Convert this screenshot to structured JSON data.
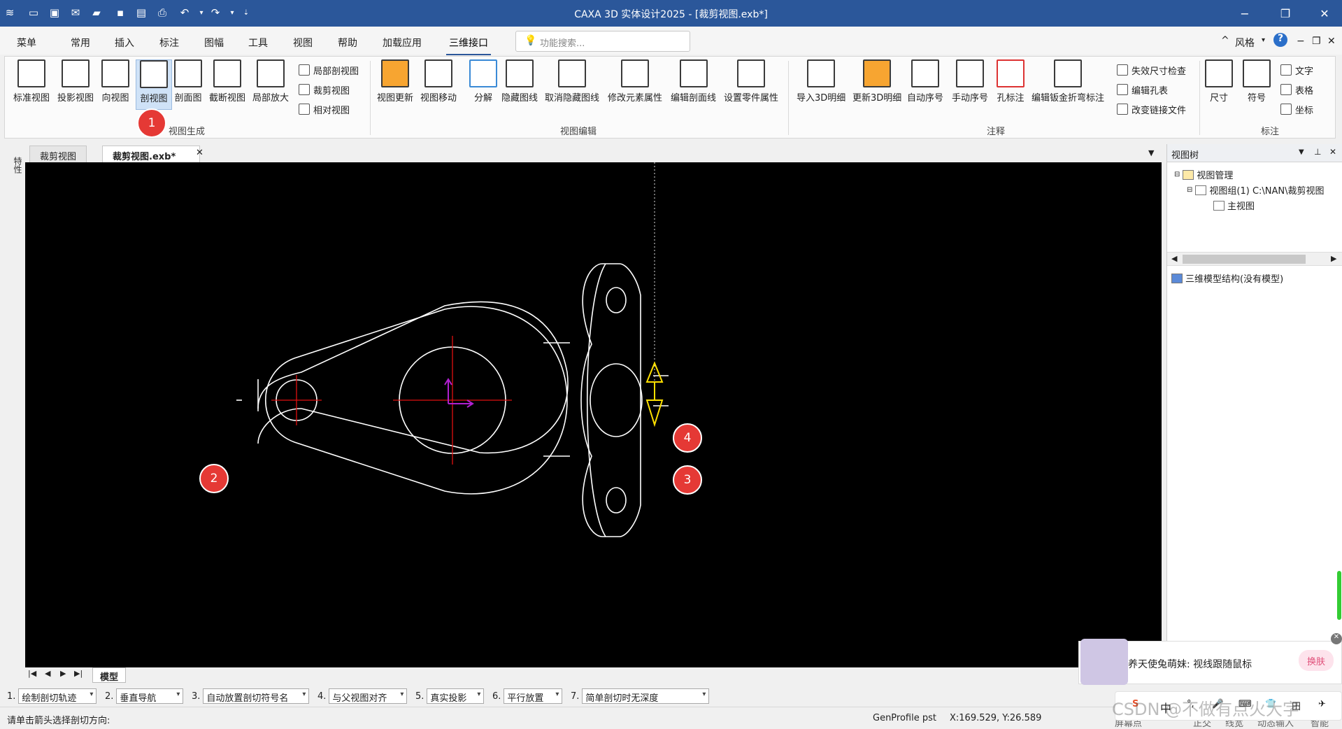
{
  "window": {
    "title": "CAXA 3D 实体设计2025 - [裁剪视图.exb*]",
    "minimize": "−",
    "maximize": "❐",
    "close": "✕"
  },
  "menubar": {
    "items": [
      "菜单",
      "常用",
      "插入",
      "标注",
      "图幅",
      "工具",
      "视图",
      "帮助",
      "加载应用",
      "三维接口"
    ],
    "active": "三维接口",
    "search_placeholder": "功能搜索...",
    "style_label": "风格",
    "help": "?"
  },
  "ribbon": {
    "groups": [
      {
        "name": "视图生成"
      },
      {
        "name": "视图编辑"
      },
      {
        "name": "注释"
      },
      {
        "name": "标注"
      }
    ],
    "view_gen": [
      "标准视图",
      "投影视图",
      "向视图",
      "剖视图",
      "剖面图",
      "截断视图",
      "局部放大"
    ],
    "view_gen_small": [
      "局部剖视图",
      "裁剪视图",
      "相对视图"
    ],
    "view_edit": [
      "视图更新",
      "视图移动",
      "分解",
      "隐藏图线",
      "取消隐藏图线",
      "修改元素属性",
      "编辑剖面线",
      "设置零件属性"
    ],
    "annot": [
      "导入3D明细",
      "更新3D明细",
      "自动序号",
      "手动序号",
      "孔标注",
      "编辑钣金折弯标注"
    ],
    "annot_small": [
      "失效尺寸检查",
      "编辑孔表",
      "改变链接文件"
    ],
    "dim": [
      "尺寸",
      "符号"
    ],
    "dim_small": [
      "文字",
      "表格",
      "坐标"
    ]
  },
  "side_tab": "特性",
  "tabs": [
    {
      "label": "裁剪视图",
      "active": false
    },
    {
      "label": "裁剪视图.exb*",
      "active": true
    }
  ],
  "layout_tab": "模型",
  "markers": [
    "1",
    "2",
    "3",
    "4"
  ],
  "options": [
    {
      "num": "1.",
      "value": "绘制剖切轨迹"
    },
    {
      "num": "2.",
      "value": "垂直导航"
    },
    {
      "num": "3.",
      "value": "自动放置剖切符号名"
    },
    {
      "num": "4.",
      "value": "与父视图对齐"
    },
    {
      "num": "5.",
      "value": "真实投影"
    },
    {
      "num": "6.",
      "value": "平行放置"
    },
    {
      "num": "7.",
      "value": "简单剖切时无深度"
    }
  ],
  "status": {
    "prompt": "请单击箭头选择剖切方向:",
    "profile": "GenProfile pst",
    "coords": "X:169.529, Y:26.589",
    "screen_point": "屏幕点",
    "ortho": "正交",
    "line_width": "线宽",
    "dynamic_input": "动态输入",
    "smart": "智能"
  },
  "viewtree": {
    "title": "视图树",
    "root": "视图管理",
    "group": "视图组(1)  C:\\NAN\\裁剪视图",
    "main": "主视图",
    "model": "三维模型结构(没有模型)"
  },
  "popup": {
    "text": "养天使兔萌妹: 视线跟随鼠标",
    "button": "换肤"
  },
  "ime": {
    "items": [
      "S",
      "中",
      "°,",
      "🎤",
      "⌨",
      "👕",
      "田",
      "✈"
    ]
  },
  "watermark": "CSDN @不做有点火大字"
}
